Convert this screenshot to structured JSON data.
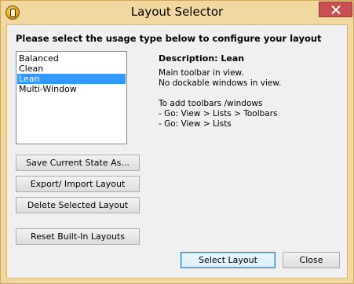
{
  "window": {
    "title": "Layout Selector",
    "app_icon": "app-logo-icon",
    "close_icon": "close-icon"
  },
  "prompt": "Please select the usage type below to configure your layout",
  "layouts": [
    {
      "label": "Balanced",
      "selected": false
    },
    {
      "label": "Clean",
      "selected": false
    },
    {
      "label": "Lean",
      "selected": true
    },
    {
      "label": "Multi-Window",
      "selected": false
    }
  ],
  "description": {
    "title": "Description: Lean",
    "lines": [
      "Main toolbar in view.",
      "No dockable windows in view.",
      "",
      "To add toolbars /windows",
      "- Go: View > Lists > Toolbars",
      "- Go: View > Lists"
    ]
  },
  "buttons": {
    "save_state": "Save Current State As...",
    "export_import": "Export/ Import Layout",
    "delete_selected": "Delete Selected Layout",
    "reset_builtin": "Reset Built-In Layouts",
    "select_layout": "Select Layout",
    "close": "Close"
  },
  "colors": {
    "frame": "#f0d8a0",
    "close_button": "#c75050",
    "selection": "#3399ff"
  }
}
